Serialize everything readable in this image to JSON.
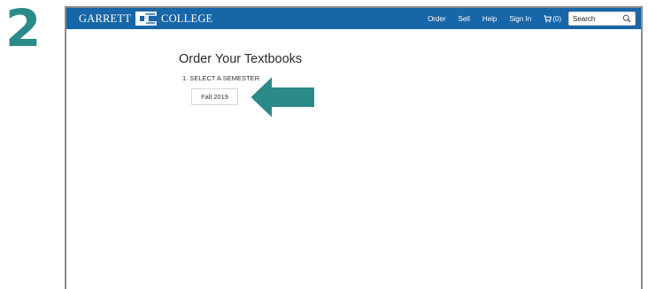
{
  "step": {
    "number": "2"
  },
  "navbar": {
    "logo_left": "GARRETT",
    "logo_right": "COLLEGE",
    "links": [
      "Order",
      "Sell",
      "Help",
      "Sign In"
    ],
    "cart_label": "(0)",
    "search_placeholder": "Search"
  },
  "main": {
    "title": "Order Your Textbooks",
    "step_label": "1. SELECT A SEMESTER",
    "semester_button": "Fall 2019"
  },
  "colors": {
    "navbar": "#1766a8",
    "step_number": "#2a8a88",
    "arrow": "#2a8a88"
  },
  "icons": {
    "logo": "gc-logo-icon",
    "cart": "cart-icon",
    "search": "search-icon",
    "arrow": "left-arrow-icon"
  }
}
